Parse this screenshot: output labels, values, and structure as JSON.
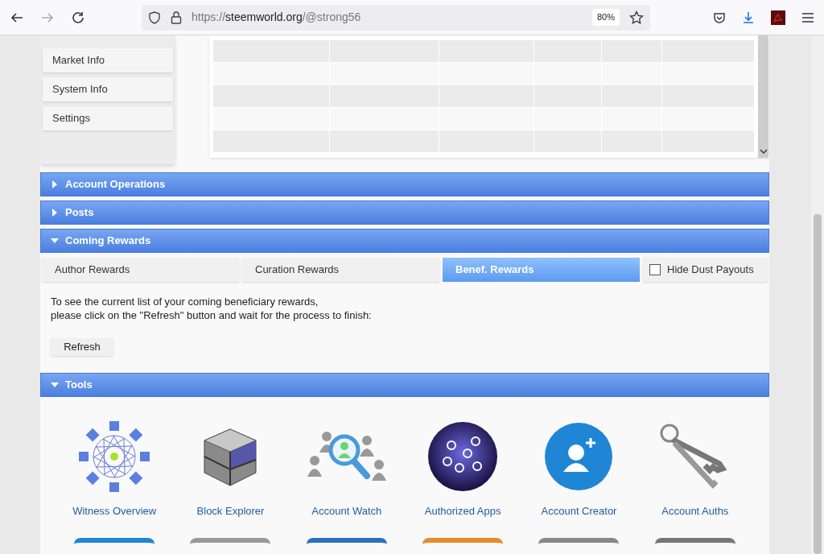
{
  "browser": {
    "url": {
      "scheme": "https://",
      "host": "steemworld.org",
      "path": "/@strong56"
    },
    "zoom": "80%"
  },
  "sidebar": {
    "items": [
      "Market Info",
      "System Info",
      "Settings"
    ]
  },
  "sections": [
    {
      "title": "Account Operations",
      "expanded": false
    },
    {
      "title": "Posts",
      "expanded": false
    },
    {
      "title": "Coming Rewards",
      "expanded": true
    },
    {
      "title": "Tools",
      "expanded": true
    }
  ],
  "coming_rewards": {
    "tabs": [
      {
        "label": "Author Rewards",
        "selected": false
      },
      {
        "label": "Curation Rewards",
        "selected": false
      },
      {
        "label": "Benef. Rewards",
        "selected": true
      }
    ],
    "hide_dust": {
      "label": "Hide Dust Payouts",
      "checked": false
    },
    "message": [
      "To see the current list of your coming beneficiary rewards,",
      "please click on the \"Refresh\" button and wait for the process to finish:"
    ],
    "refresh_button": "Refresh"
  },
  "tools": [
    {
      "label": "Witness Overview",
      "kind": "network"
    },
    {
      "label": "Block Explorer",
      "kind": "cube"
    },
    {
      "label": "Account Watch",
      "kind": "magnifier"
    },
    {
      "label": "Authorized Apps",
      "kind": "globe"
    },
    {
      "label": "Account Creator",
      "kind": "adduser"
    },
    {
      "label": "Account Auths",
      "kind": "keys"
    }
  ]
}
